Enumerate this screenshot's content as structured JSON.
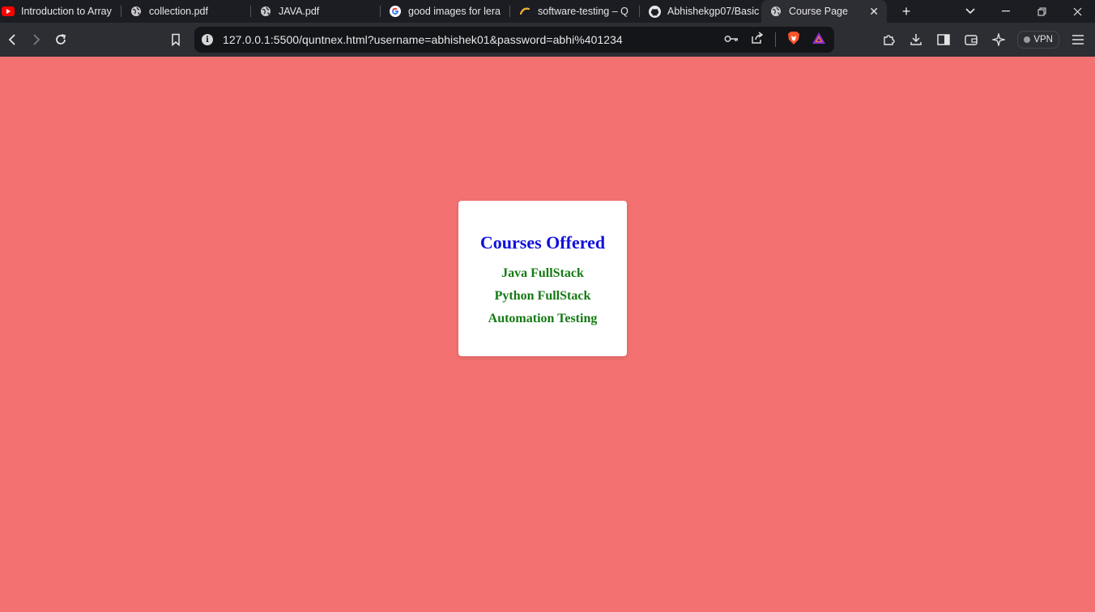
{
  "tabs": [
    {
      "label": "Introduction to Array",
      "icon": "youtube-icon"
    },
    {
      "label": "collection.pdf",
      "icon": "globe-icon"
    },
    {
      "label": "JAVA.pdf",
      "icon": "globe-icon"
    },
    {
      "label": "good images for lera",
      "icon": "google-icon"
    },
    {
      "label": "software-testing – Q",
      "icon": "link-icon"
    },
    {
      "label": "Abhishekgp07/Basic",
      "icon": "github-icon"
    },
    {
      "label": "Course Page",
      "icon": "globe-icon",
      "active": true
    }
  ],
  "address_bar": {
    "url": "127.0.0.1:5500/quntnex.html?username=abhishek01&password=abhi%401234"
  },
  "toolbar": {
    "vpn_label": "VPN"
  },
  "page": {
    "background_color": "#f47171",
    "card": {
      "title": "Courses Offered",
      "title_color": "#1111dd",
      "course_color": "#137a13",
      "courses": [
        "Java FullStack",
        "Python FullStack",
        "Automation Testing"
      ]
    }
  }
}
